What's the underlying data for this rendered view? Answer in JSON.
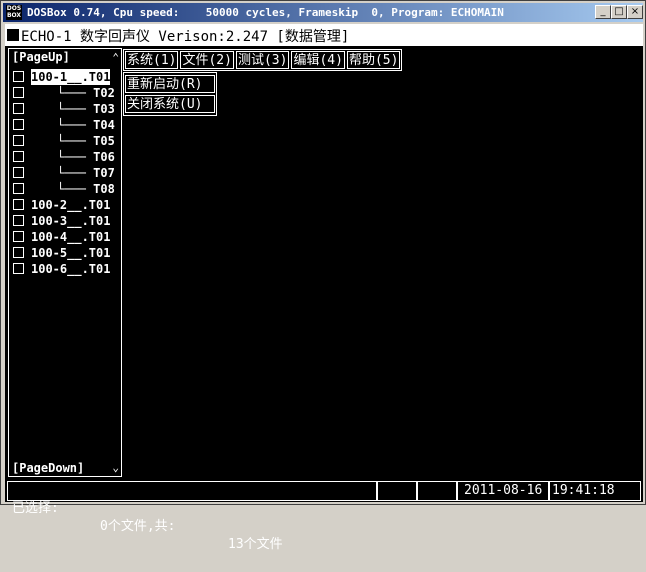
{
  "window": {
    "icon_label": "DOS BOX",
    "title": "DOSBox 0.74, Cpu speed:    50000 cycles, Frameskip  0, Program: ECHOMAIN",
    "minimize": "_",
    "maximize": "□",
    "close": "×"
  },
  "header": {
    "title": "ECHO-1 数字回声仪 Verison:2.247 [数据管理]"
  },
  "left_panel": {
    "page_up": "[PageUp]",
    "page_down": "[PageDown]",
    "up_arrow": "⌃",
    "down_arrow": "⌄",
    "files": [
      {
        "label": "100-1__.T01",
        "selected": true
      },
      {
        "label": "└─── T02",
        "selected": false
      },
      {
        "label": "└─── T03",
        "selected": false
      },
      {
        "label": "└─── T04",
        "selected": false
      },
      {
        "label": "└─── T05",
        "selected": false
      },
      {
        "label": "└─── T06",
        "selected": false
      },
      {
        "label": "└─── T07",
        "selected": false
      },
      {
        "label": "└─── T08",
        "selected": false
      },
      {
        "label": "100-2__.T01",
        "selected": false
      },
      {
        "label": "100-3__.T01",
        "selected": false
      },
      {
        "label": "100-4__.T01",
        "selected": false
      },
      {
        "label": "100-5__.T01",
        "selected": false
      },
      {
        "label": "100-6__.T01",
        "selected": false
      }
    ]
  },
  "menu": {
    "items": [
      "系统(1)",
      "文件(2)",
      "测试(3)",
      "编辑(4)",
      "帮助(5)"
    ],
    "dropdown": [
      "重新启动(R)",
      "关闭系统(U)"
    ]
  },
  "status": {
    "selected_label": "已选择:",
    "selected_value": "0个文件,共:",
    "total_value": "13个文件",
    "date": "2011-08-16",
    "time": "19:41:18"
  }
}
